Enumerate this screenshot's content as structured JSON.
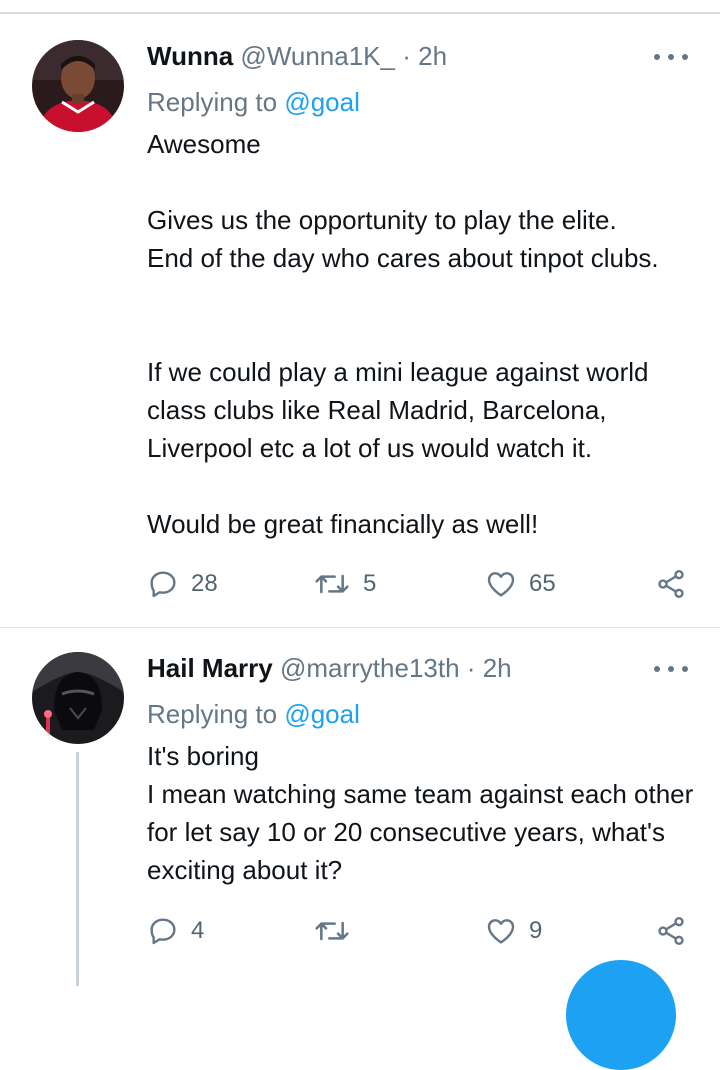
{
  "tweets": [
    {
      "name": "Wunna",
      "handle": "@Wunna1K_",
      "time": "2h",
      "replying_prefix": "Replying to",
      "replying_to": "@goal",
      "body": [
        "Awesome",
        "Gives us the opportunity to play the elite.\nEnd of the day who cares about tinpot clubs.",
        "If we could play a mini league against world class clubs like Real Madrid, Barcelona, Liverpool etc a lot of us would watch it.",
        "Would be great financially as well!"
      ],
      "replies": "28",
      "retweets": "5",
      "likes": "65"
    },
    {
      "name": "Hail Marry",
      "handle": "@marrythe13th",
      "time": "2h",
      "replying_prefix": "Replying to",
      "replying_to": "@goal",
      "body": [
        "It's boring\nI mean watching same team against each other for let say 10 or 20 consecutive years, what's exciting about it?"
      ],
      "replies": "4",
      "retweets": "",
      "likes": "9"
    }
  ],
  "separator": "·",
  "icons": {
    "reply": "reply-icon",
    "retweet": "retweet-icon",
    "like": "heart-icon",
    "share": "share-icon",
    "more": "more-icon"
  },
  "colors": {
    "accent": "#1da1f2",
    "secondary_text": "#657786",
    "primary_text": "#0f1419"
  }
}
